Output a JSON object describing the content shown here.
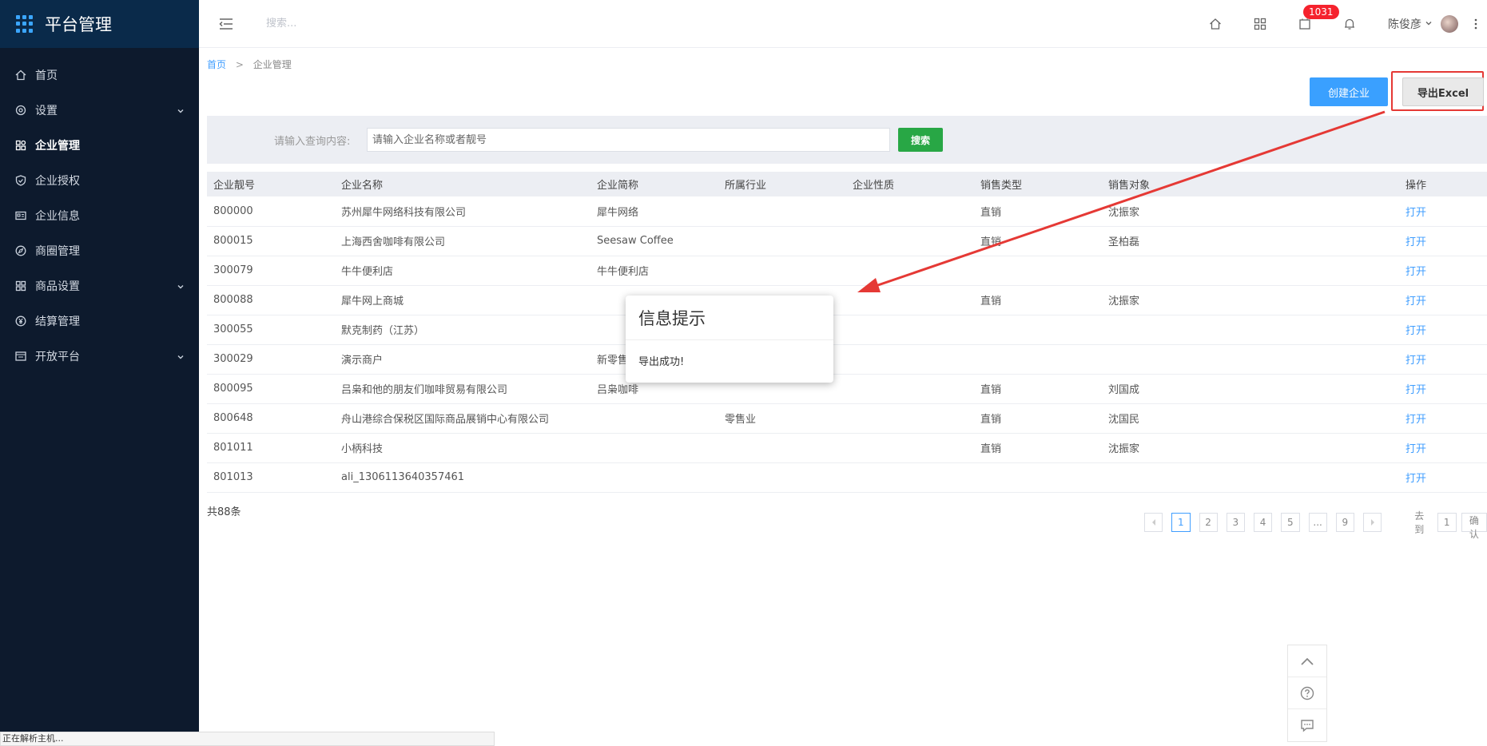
{
  "sidebar": {
    "title": "平台管理",
    "items": [
      {
        "label": "首页",
        "icon": "home-icon"
      },
      {
        "label": "设置",
        "icon": "settings-icon"
      },
      {
        "label": "企业管理",
        "icon": "enterprise-icon"
      },
      {
        "label": "企业授权",
        "icon": "shield-icon"
      },
      {
        "label": "企业信息",
        "icon": "id-card-icon"
      },
      {
        "label": "商圈管理",
        "icon": "compass-icon"
      },
      {
        "label": "商品设置",
        "icon": "grid-icon"
      },
      {
        "label": "结算管理",
        "icon": "yen-icon"
      },
      {
        "label": "开放平台",
        "icon": "platform-icon"
      }
    ]
  },
  "topbar": {
    "search_placeholder": "搜索...",
    "badge_count": "1031",
    "user_name": "陈俊彦"
  },
  "breadcrumb": {
    "home": "首页",
    "separator": ">",
    "current": "企业管理"
  },
  "actions": {
    "create": "创建企业",
    "export": "导出Excel"
  },
  "search": {
    "label": "请输入查询内容:",
    "placeholder": "请输入企业名称或者靓号",
    "button": "搜索"
  },
  "table": {
    "headers": [
      "企业靓号",
      "企业名称",
      "企业简称",
      "所属行业",
      "企业性质",
      "销售类型",
      "销售对象",
      "操作"
    ],
    "rows": [
      [
        "800000",
        "苏州犀牛网络科技有限公司",
        "犀牛网络",
        "",
        "",
        "直销",
        "沈振家",
        "打开"
      ],
      [
        "800015",
        "上海西舍咖啡有限公司",
        "Seesaw Coffee",
        "",
        "",
        "直销",
        "圣柏磊",
        "打开"
      ],
      [
        "300079",
        "牛牛便利店",
        "牛牛便利店",
        "",
        "",
        "",
        "",
        "打开"
      ],
      [
        "800088",
        "犀牛网上商城",
        "",
        "",
        "",
        "直销",
        "沈振家",
        "打开"
      ],
      [
        "300055",
        "默克制药（江苏）",
        "",
        "",
        "",
        "",
        "",
        "打开"
      ],
      [
        "300029",
        "演示商户",
        "新零售",
        "",
        "",
        "",
        "",
        "打开"
      ],
      [
        "800095",
        "吕枭和他的朋友们咖啡贸易有限公司",
        "吕枭咖啡",
        "",
        "",
        "直销",
        "刘国成",
        "打开"
      ],
      [
        "800648",
        "舟山港综合保税区国际商品展销中心有限公司",
        "",
        "零售业",
        "",
        "直销",
        "沈国民",
        "打开"
      ],
      [
        "801011",
        "小柄科技",
        "",
        "",
        "",
        "直销",
        "沈振家",
        "打开"
      ],
      [
        "801013",
        "ali_1306113640357461",
        "",
        "",
        "",
        "",
        "",
        "打开"
      ]
    ]
  },
  "pagination": {
    "total": "共88条",
    "pages": [
      "1",
      "2",
      "3",
      "4",
      "5",
      "...",
      "9"
    ],
    "current": "1",
    "goto_label": "去到",
    "goto_value": "1",
    "confirm": "确认"
  },
  "dialog": {
    "title": "信息提示",
    "message": "导出成功!"
  },
  "status_bar": "正在解析主机...",
  "colors": {
    "sidebar_bg": "#0d1a2d",
    "primary": "#3aa0ff",
    "search_button": "#28a745",
    "badge": "#f5222d",
    "annotation": "#e53935"
  }
}
